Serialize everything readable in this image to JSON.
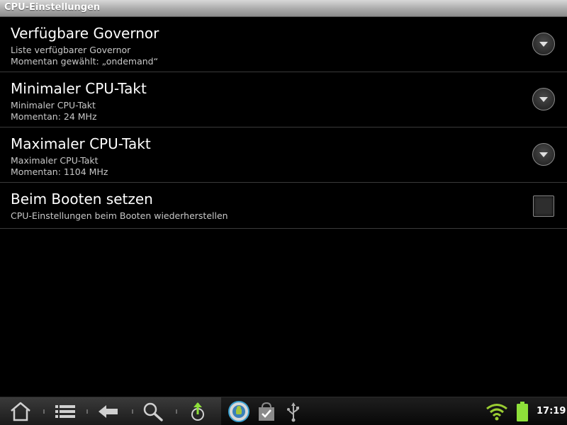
{
  "window": {
    "title": "CPU-Einstellungen"
  },
  "preferences": [
    {
      "title": "Verfügbare Governor",
      "summary_line1": "Liste verfügbarer Governor",
      "summary_line2": "Momentan gewählt: „ondemand“",
      "widget": "dropdown"
    },
    {
      "title": "Minimaler CPU-Takt",
      "summary_line1": "Minimaler CPU-Takt",
      "summary_line2": "Momentan: 24 MHz",
      "widget": "dropdown"
    },
    {
      "title": "Maximaler CPU-Takt",
      "summary_line1": "Maximaler CPU-Takt",
      "summary_line2": "Momentan: 1104 MHz",
      "widget": "dropdown"
    },
    {
      "title": "Beim Booten setzen",
      "summary_line1": "CPU-Einstellungen beim Booten wiederherstellen",
      "widget": "checkbox",
      "checked": false
    }
  ],
  "system_bar": {
    "nav_icons": [
      "home-icon",
      "menu-icon",
      "back-icon",
      "search-icon",
      "upload-icon"
    ],
    "notification_icons": [
      "sync-app-icon",
      "market-bag-icon",
      "usb-icon"
    ],
    "status_icons": [
      "wifi-icon",
      "battery-icon"
    ],
    "clock": "17:19"
  },
  "colors": {
    "background": "#000000",
    "title_text": "#ffffff",
    "summary_text": "#c8c8c8",
    "divider": "#3a3a3a",
    "wifi": "#9acd32",
    "battery": "#8ee03a"
  }
}
